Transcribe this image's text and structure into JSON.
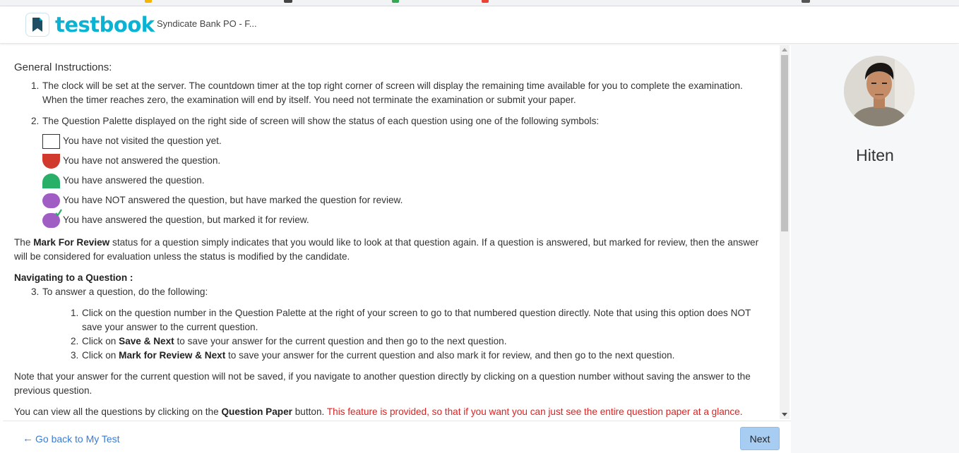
{
  "header": {
    "logo_text": "testbook",
    "test_title": "Syndicate Bank PO - F..."
  },
  "instructions": {
    "heading": "General Instructions:",
    "item1_num": "1.",
    "item1": "The clock will be set at the server. The countdown timer at the top right corner of screen will display the remaining time available for you to complete the examination. When the timer reaches zero, the examination will end by itself. You need not terminate the examination or submit your paper.",
    "item2_num": "2.",
    "item2": "The Question Palette displayed on the right side of screen will show the status of each question using one of the following symbols:",
    "symbols": [
      {
        "label": "You have not visited the question yet.",
        "color": "#ffffff"
      },
      {
        "label": "You have not answered the question.",
        "color": "#d0392b"
      },
      {
        "label": "You have answered the question.",
        "color": "#28b068"
      },
      {
        "label": "You have NOT answered the question, but have marked the question for review.",
        "color": "#a05ec4"
      },
      {
        "label": "You have answered the question, but marked it for review.",
        "color": "#a05ec4"
      }
    ],
    "review_pre": "The ",
    "review_bold": "Mark For Review",
    "review_post": " status for a question simply indicates that you would like to look at that question again. If a question is answered, but marked for review, then the answer will be considered for evaluation unless the status is modified by the candidate.",
    "nav_heading": "Navigating to a Question :",
    "item3_num": "3.",
    "item3": "To answer a question, do the following:",
    "sub": {
      "s1_num": "1.",
      "s1": "Click on the question number in the Question Palette at the right of your screen to go to that numbered question directly. Note that using this option does NOT save your answer to the current question.",
      "s2_num": "2.",
      "s2_pre": "Click on ",
      "s2_bold": "Save & Next",
      "s2_post": " to save your answer for the current question and then go to the next question.",
      "s3_num": "3.",
      "s3_pre": "Click on ",
      "s3_bold": "Mark for Review & Next",
      "s3_post": " to save your answer for the current question and also mark it for review, and then go to the next question."
    },
    "note": "Note that your answer for the current question will not be saved, if you navigate to another question directly by clicking on a question number without saving the answer to the previous question.",
    "qp_pre": "You can view all the questions by clicking on the ",
    "qp_bold": "Question Paper",
    "qp_mid": " button. ",
    "qp_red": "This feature is provided, so that if you want you can just see the entire question paper at a glance."
  },
  "profile": {
    "name": "Hiten"
  },
  "footer": {
    "back_label": "Go back to My Test",
    "next_label": "Next"
  },
  "colors": {
    "brand": "#0ab3d4",
    "link": "#3a7bd5",
    "button": "#a8cdf3",
    "highlight_text": "#e02020"
  }
}
